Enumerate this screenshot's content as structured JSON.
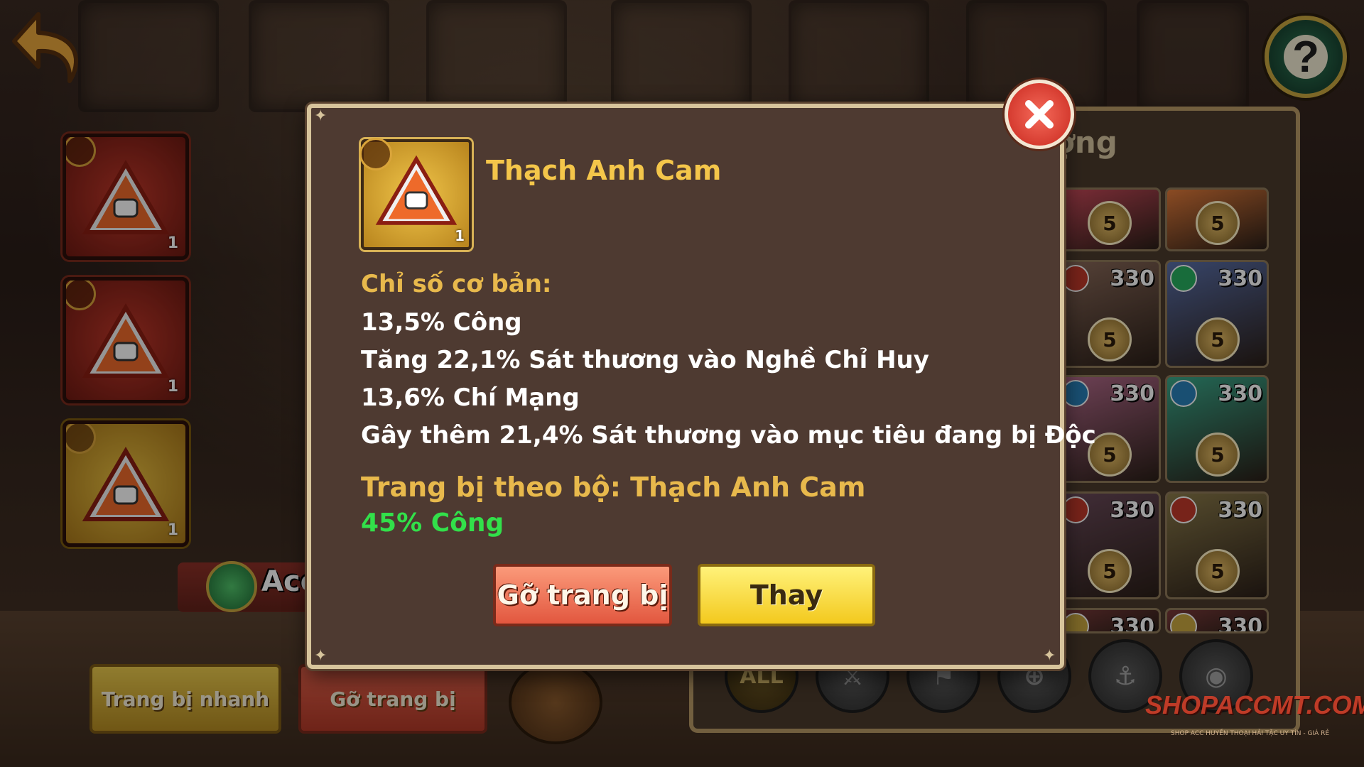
{
  "help": {
    "label": "?"
  },
  "left_slots": [
    {
      "qty": "1",
      "style": "red"
    },
    {
      "qty": "1",
      "style": "red"
    },
    {
      "qty": "1",
      "style": "gold"
    }
  ],
  "hero": {
    "name": "Ace"
  },
  "bottom": {
    "quick_equip": "Trang bị nhanh",
    "unequip": "Gỡ trang bị"
  },
  "list_panel": {
    "title_partial": "ợng"
  },
  "hero_cards": [
    {
      "level": "",
      "stars": "5",
      "color": "#c94a5a"
    },
    {
      "level": "",
      "stars": "5",
      "color": "#e07a3a"
    },
    {
      "level": "330",
      "stars": "5",
      "color": "#8a6a5a",
      "type_color": "#c0392b"
    },
    {
      "level": "330",
      "stars": "5",
      "color": "#5a6fa8",
      "type_color": "#27ae60"
    },
    {
      "level": "330",
      "stars": "5",
      "color": "#b26a8a",
      "type_color": "#2980b9"
    },
    {
      "level": "330",
      "stars": "5",
      "color": "#3aa88a",
      "type_color": "#2980b9"
    },
    {
      "level": "330",
      "stars": "5",
      "color": "#6a4a5a",
      "type_color": "#c0392b"
    },
    {
      "level": "330",
      "stars": "5",
      "color": "#8a7a4a",
      "type_color": "#c0392b"
    },
    {
      "level": "330",
      "stars": "",
      "color": "#7a3a3a",
      "type_color": "#c9a640"
    },
    {
      "level": "330",
      "stars": "",
      "color": "#7a3a3a",
      "type_color": "#c9a640"
    }
  ],
  "filters": {
    "all": "ALL"
  },
  "modal": {
    "item_name": "Thạch Anh Cam",
    "item_qty": "1",
    "base_stats_label": "Chỉ số cơ bản:",
    "stats": [
      "13,5% Công",
      "Tăng 22,1% Sát thương vào Nghề Chỉ Huy",
      "13,6% Chí Mạng",
      "Gây thêm 21,4% Sát thương vào mục tiêu đang bị Độc"
    ],
    "set_label": "Trang bị theo bộ: Thạch Anh Cam",
    "set_bonus": "45% Công",
    "unequip_button": "Gỡ trang bị",
    "replace_button": "Thay"
  },
  "watermark": {
    "text": "SHOPACCMT.COM",
    "sub": "SHOP ACC HUYỀN THOẠI HẢI TẶC UY TÍN - GIÁ RẺ"
  },
  "colors": {
    "item_name": "#f4c64a",
    "label": "#e8b94c",
    "set_bonus": "#32e04a",
    "modal_bg": "#4e3a31"
  }
}
